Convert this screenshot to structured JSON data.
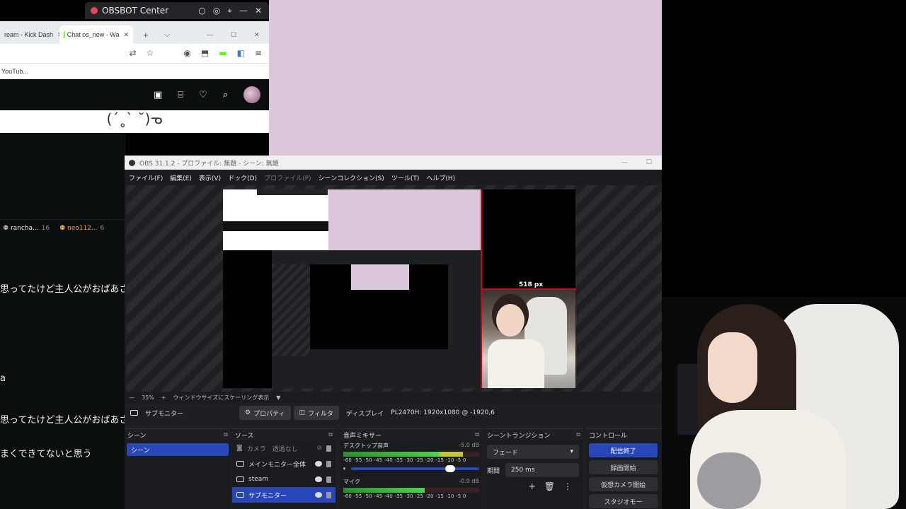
{
  "obsbot": {
    "title": "OBSBOT Center",
    "controls": [
      "○",
      "◎",
      "⌖",
      "—",
      "✕"
    ]
  },
  "browser": {
    "tabs": [
      {
        "label": "ream - Kick Dash"
      },
      {
        "label": "Chat os_new - Wa"
      }
    ],
    "new_tab": "+",
    "tab_menu": "⌵",
    "win_controls": [
      "—",
      "☐",
      "✕"
    ],
    "bookmark": "YouTub..."
  },
  "kick": {
    "banner_text": "(ˊ˳ˋ ˘)ᓀ"
  },
  "chat": {
    "users": [
      {
        "name": "rancha...",
        "count": "16"
      },
      {
        "name": "neo112...",
        "count": "6"
      }
    ],
    "lines": [
      {
        "text": "思ってたけど主人公がおばあさ"
      },
      {
        "text": "a"
      },
      {
        "text": "思ってたけど主人公がおばあさ"
      },
      {
        "text": "まくできてないと思う"
      }
    ]
  },
  "obs": {
    "title": "OBS 31.1.2 - プロファイル: 無題 - シーン: 無題",
    "win_controls": [
      "—",
      "☐"
    ],
    "menu": [
      {
        "label": "ファイル(F)",
        "enabled": true
      },
      {
        "label": "編集(E)",
        "enabled": true
      },
      {
        "label": "表示(V)",
        "enabled": true
      },
      {
        "label": "ドック(D)",
        "enabled": true
      },
      {
        "label": "プロファイル(P)",
        "enabled": false
      },
      {
        "label": "シーンコレクション(S)",
        "enabled": true
      },
      {
        "label": "ツール(T)",
        "enabled": true
      },
      {
        "label": "ヘルプ(H)",
        "enabled": true
      }
    ],
    "preview_label": "518 px",
    "zoom": {
      "minus": "—",
      "value": "35%",
      "plus": "+",
      "label": "ウィンドウサイズにスケーリング表示",
      "dropdown": "▼"
    },
    "props_bar": {
      "source": "サブモニター",
      "properties_label": "プロパティ",
      "filters_label": "フィルタ",
      "display_label": "ディスプレイ",
      "display_value": "PL2470H: 1920x1080 @ -1920,6"
    },
    "docks": {
      "scenes": {
        "title": "シーン",
        "items": [
          "シーン"
        ]
      },
      "sources": {
        "title": "ソース",
        "items": [
          {
            "name": "カメラ　透過なし",
            "icon": "camera-icon",
            "state": "hidden"
          },
          {
            "name": "メインモニター全体",
            "icon": "monitor-icon",
            "state": "visible"
          },
          {
            "name": "steam",
            "icon": "monitor-icon",
            "state": "visible"
          },
          {
            "name": "サブモニター",
            "icon": "monitor-icon",
            "state": "selected"
          }
        ]
      },
      "mixer": {
        "title": "音声ミキサー",
        "tracks": [
          {
            "name": "デスクトップ音声",
            "db": "-5.0 dB",
            "level": 0.88,
            "scale": "-60 -55 -50 -45 -40 -35 -30 -25 -20 -15 -10 -5 0"
          },
          {
            "name": "マイク",
            "db": "-0.9 dB",
            "level": 0.6,
            "scale": "-60 -55 -50 -45 -40 -35 -30 -25 -20 -15 -10 -5 0"
          }
        ]
      },
      "transitions": {
        "title": "シーントランジション",
        "selected": "フェード",
        "duration_label": "期間",
        "duration_value": "250 ms"
      },
      "controls": {
        "title": "コントロール",
        "buttons": [
          "配信終了",
          "録画開始",
          "仮想カメラ開始",
          "スタジオモー"
        ]
      }
    }
  },
  "colors": {
    "obs_accent": "#2946b8",
    "desktop_lilac": "#dbc7da",
    "kick_green": "#53fc18",
    "red_guide": "#d0021b"
  }
}
